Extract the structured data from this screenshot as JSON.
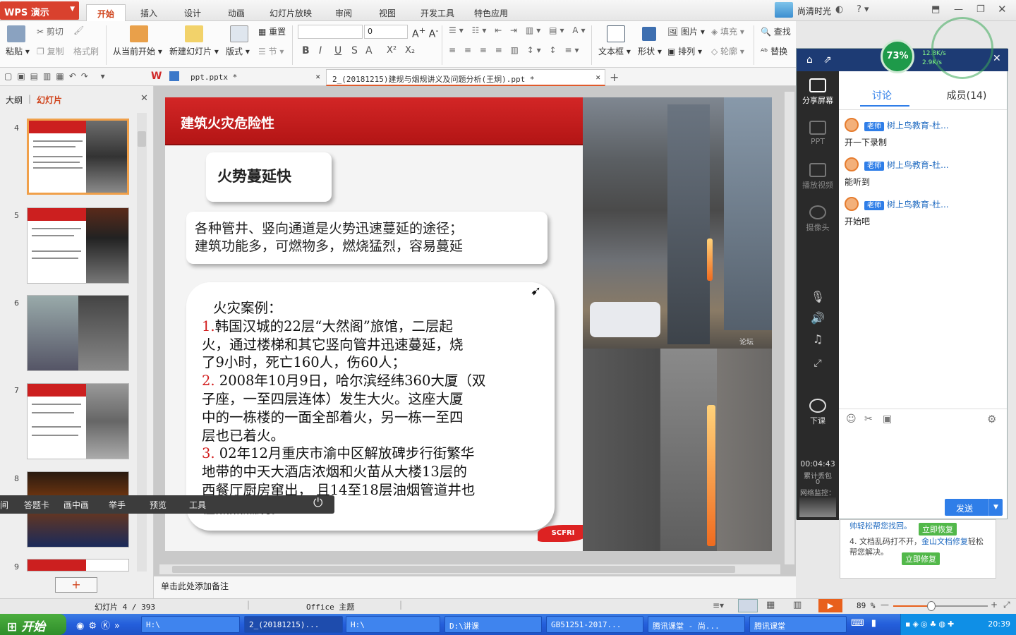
{
  "app": {
    "menu_label": "WPS 演示"
  },
  "tabs": [
    "开始",
    "插入",
    "设计",
    "动画",
    "幻灯片放映",
    "审阅",
    "视图",
    "开发工具",
    "特色应用"
  ],
  "user": "尚清时光",
  "ribbon": {
    "paste": "粘贴",
    "cut": "剪切",
    "copy": "复制",
    "format_brush": "格式刷",
    "from_current": "从当前开始",
    "new_slide": "新建幻灯片",
    "layout": "版式",
    "reset": "重置",
    "section": "节",
    "font_size": "0",
    "textbox": "文本框",
    "shape": "形状",
    "picture": "图片",
    "fill": "填充",
    "arrange": "排列",
    "outline": "轮廓",
    "find": "查找",
    "replace": "替换",
    "format_buttons": [
      "B",
      "I",
      "U",
      "S",
      "A",
      "X²",
      "X₂"
    ]
  },
  "doc_tabs": [
    "ppt.pptx *",
    "2_(20181215)建规与烟规讲义及问题分析(王炯).ppt *"
  ],
  "left_pane": {
    "outline_tab": "大纲",
    "slides_tab": "幻灯片",
    "slide_numbers": [
      "4",
      "5",
      "6",
      "7",
      "8",
      "9"
    ],
    "add_button": "+"
  },
  "slide": {
    "title": "建筑火灾危险性",
    "subtitle": "火势蔓延快",
    "intro_line1": "各种管井、竖向通道是火势迅速蔓延的途径；",
    "intro_line2": "建筑功能多，可燃物多，燃烧猛烈，容易蔓延",
    "cases_heading": "火灾案例：",
    "case1_num": "1.",
    "case1_lines": [
      "韩国汉城的22层“大然阁”旅馆，二层起",
      "火，通过楼梯和其它竖向管井迅速蔓延，烧",
      "了9小时，死亡160人，伤60人；"
    ],
    "case2_num": "2.",
    "case2_lines": [
      " 2008年10月9日，哈尔滨经纬360大厦（双",
      "子座，一至四层连体）发生大火。这座大厦",
      "中的一栋楼的一面全部着火，另一栋一至四",
      "层也已着火。"
    ],
    "case3_num": "3.",
    "case3_lines": [
      " 02年12月重庆市渝中区解放碑步行街繁华",
      "地带的中天大酒店浓烟和火苗从大楼13层的",
      "西餐厅厨房窜出，  且14至18层油烟管道井也",
      "在熊熊燃烧。"
    ],
    "logo_text": "SCFRI",
    "watermark": "论坛"
  },
  "notes_placeholder": "单击此处添加备注",
  "floatbar": [
    "答题卡",
    "画中画",
    "举手",
    "预览",
    "工具"
  ],
  "tencent": {
    "progress": "73%",
    "speed_up": "12.8K/s",
    "speed_down": "2.9K/s",
    "tabs": [
      "讨论",
      "成员(14)"
    ],
    "side": [
      "分享屏幕",
      "PPT",
      "播放视频",
      "摄像头"
    ],
    "end_class": "下课",
    "timer": "00:04:43",
    "timer_label": "累计丢包",
    "loss_value": "0",
    "net_label": "网络监控：",
    "role_badge": "老师",
    "sender": "树上鸟教育-杜...",
    "messages": [
      "开一下录制",
      "能听到",
      "开始吧"
    ],
    "send": "发送"
  },
  "repair_tip": {
    "line1": "帅轻松帮您找回。",
    "btn1": "立即恢复",
    "line2a": "4. 文档乱码打不开，",
    "line2b": "金山文档修复",
    "line2c": "轻松帮您解决。",
    "btn2": "立即修复"
  },
  "status": {
    "slide_info": "幻灯片 4 / 393",
    "theme": "Office 主题",
    "zoom": "89 %",
    "zoom_level": 0.4
  },
  "taskbar": {
    "start": "开始",
    "items": [
      "H:\\",
      "2_(20181215)...",
      "H:\\",
      "D:\\讲课",
      "GB51251-2017...",
      "腾讯课堂 - 尚...",
      "腾讯课堂"
    ],
    "clock": "20:39"
  },
  "colors": {
    "accent": "#d0441c",
    "slide_red": "#cc1f1f",
    "tencent_blue": "#2f7ee8"
  }
}
